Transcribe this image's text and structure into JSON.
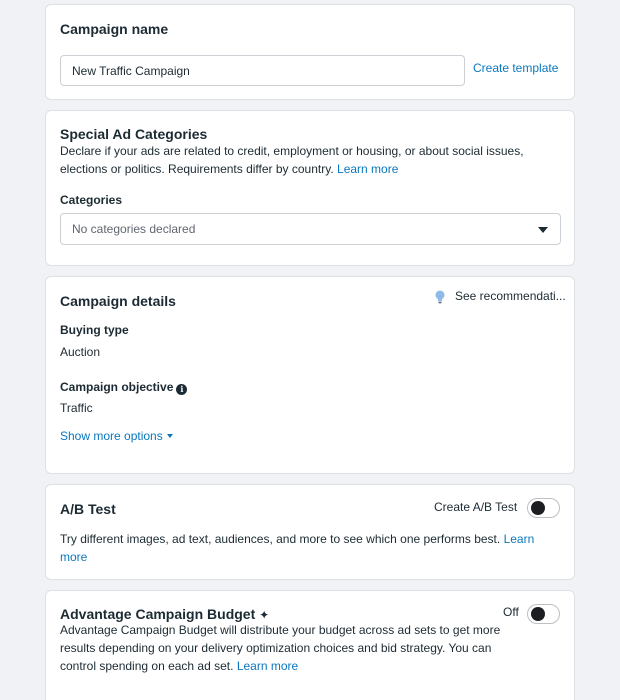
{
  "campaign_name": {
    "title": "Campaign name",
    "input_value": "New Traffic Campaign",
    "create_template_link": "Create template"
  },
  "special_ad_categories": {
    "title": "Special Ad Categories",
    "description": "Declare if your ads are related to credit, employment or housing, or about social issues, elections or politics. Requirements differ by country.",
    "learn_more": "Learn more",
    "categories_label": "Categories",
    "categories_select": "No categories declared"
  },
  "campaign_details": {
    "title": "Campaign details",
    "see_recommendations": "See recommendati...",
    "buying_type_label": "Buying type",
    "buying_type_value": "Auction",
    "objective_label": "Campaign objective",
    "objective_value": "Traffic",
    "show_more_options": "Show more options"
  },
  "ab_test": {
    "title": "A/B Test",
    "toggle_label": "Create A/B Test",
    "description": "Try different images, ad text, audiences, and more to see which one performs best.",
    "learn_more": "Learn more"
  },
  "advantage_budget": {
    "title": "Advantage Campaign Budget",
    "sparkle": "✦",
    "toggle_label": "Off",
    "description": "Advantage Campaign Budget will distribute your budget across ad sets to get more results depending on your delivery optimization choices and bid strategy. You can control spending on each ad set.",
    "learn_more": "Learn more"
  },
  "colors": {
    "link": "#0a78be",
    "text": "#1c2b33",
    "background": "#f0f2f5",
    "bulb": "#8fb9e6"
  }
}
